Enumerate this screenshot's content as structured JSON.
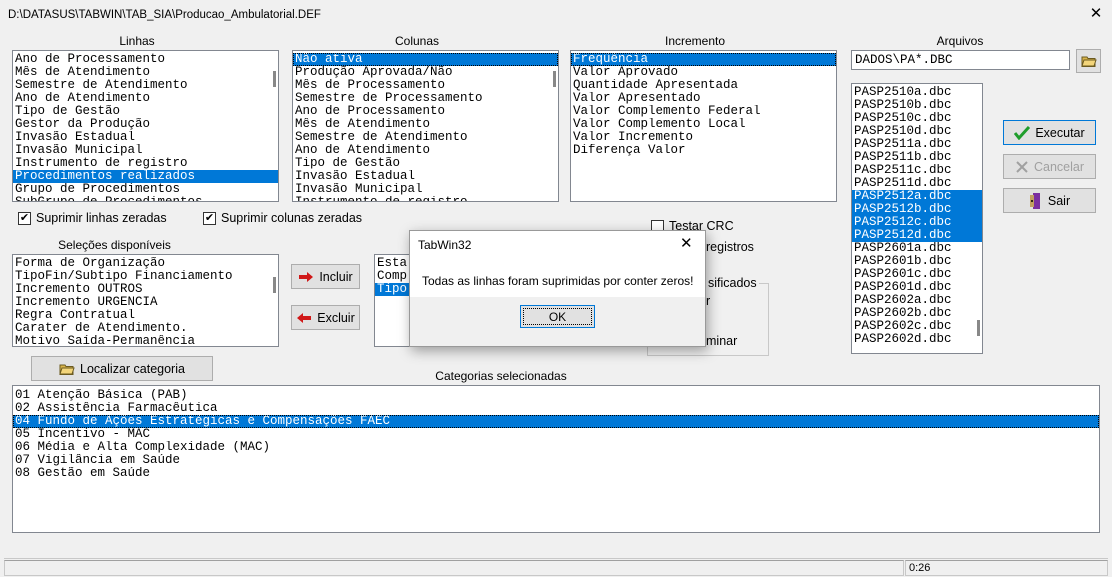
{
  "window": {
    "title": "D:\\DATASUS\\TABWIN\\TAB_SIA\\Producao_Ambulatorial.DEF"
  },
  "labels": {
    "linhas": "Linhas",
    "colunas": "Colunas",
    "incremento": "Incremento",
    "arquivos": "Arquivos",
    "selecoes": "Seleções disponíveis",
    "categorias": "Categorias selecionadas"
  },
  "linhas": [
    "Ano de Processamento",
    "Mês de Atendimento",
    "Semestre de Atendimento",
    "Ano de Atendimento",
    "Tipo de Gestão",
    "Gestor da Produção",
    "Invasão Estadual",
    "Invasão Municipal",
    "Instrumento de registro",
    "Procedimentos realizados",
    "Grupo de Procedimentos",
    "SubGrupo de Procedimentos"
  ],
  "colunas": [
    "Não ativa",
    "Produção Aprovada/Não",
    "Mês de Processamento",
    "Semestre de Processamento",
    "Ano de Processamento",
    "Mês de Atendimento",
    "Semestre de Atendimento",
    "Ano de Atendimento",
    "Tipo de Gestão",
    "Invasão Estadual",
    "Invasão Municipal",
    "Instrumento de registro"
  ],
  "incremento": [
    "Freqüência",
    "Valor Aprovado",
    "Quantidade Apresentada",
    "Valor Apresentado",
    "Valor Complemento Federal",
    "Valor Complemento Local",
    "Valor Incremento",
    "Diferença Valor"
  ],
  "arquivos_input": "DADOS\\PA*.DBC",
  "arquivos": [
    "PASP2510a.dbc",
    "PASP2510b.dbc",
    "PASP2510c.dbc",
    "PASP2510d.dbc",
    "PASP2511a.dbc",
    "PASP2511b.dbc",
    "PASP2511c.dbc",
    "PASP2511d.dbc",
    "PASP2512a.dbc",
    "PASP2512b.dbc",
    "PASP2512c.dbc",
    "PASP2512d.dbc",
    "PASP2601a.dbc",
    "PASP2601b.dbc",
    "PASP2601c.dbc",
    "PASP2601d.dbc",
    "PASP2602a.dbc",
    "PASP2602b.dbc",
    "PASP2602c.dbc",
    "PASP2602d.dbc"
  ],
  "checks": {
    "suprimir_linhas": "Suprimir linhas zeradas",
    "suprimir_colunas": "Suprimir colunas zeradas",
    "testar_crc": "Testar CRC",
    "registros": "registros"
  },
  "buttons": {
    "executar": "Executar",
    "cancelar": "Cancelar",
    "sair": "Sair",
    "incluir": "Incluir",
    "excluir": "Excluir",
    "localizar": "Localizar categoria"
  },
  "selecoes": [
    "Forma de  Organização",
    "TipoFin/Subtipo Financiamento",
    "Incremento OUTROS",
    "Incremento URGENCIA",
    "Regra Contratual",
    "Carater de Atendimento.",
    "Motivo Saída-Permanência"
  ],
  "selected_items": [
    "Esta",
    "Comp",
    "Tipo"
  ],
  "group_partial": {
    "legend": "sificados",
    "line1": "r",
    "line2": "minar"
  },
  "categorias": [
    "01 Atenção Básica (PAB)",
    "02 Assistência Farmacêutica",
    "04 Fundo de Ações Estratégicas e Compensações FAEC",
    "05 Incentivo - MAC",
    "06 Média e Alta Complexidade (MAC)",
    "07 Vigilância em Saúde",
    "08 Gestão em Saúde"
  ],
  "dialog": {
    "title": "TabWin32",
    "message": "Todas as linhas foram suprimidas por conter zeros!",
    "ok": "OK"
  },
  "status": {
    "time": "0:26"
  },
  "colors": {
    "selection": "#0078d7",
    "background": "#f0f0f0"
  }
}
